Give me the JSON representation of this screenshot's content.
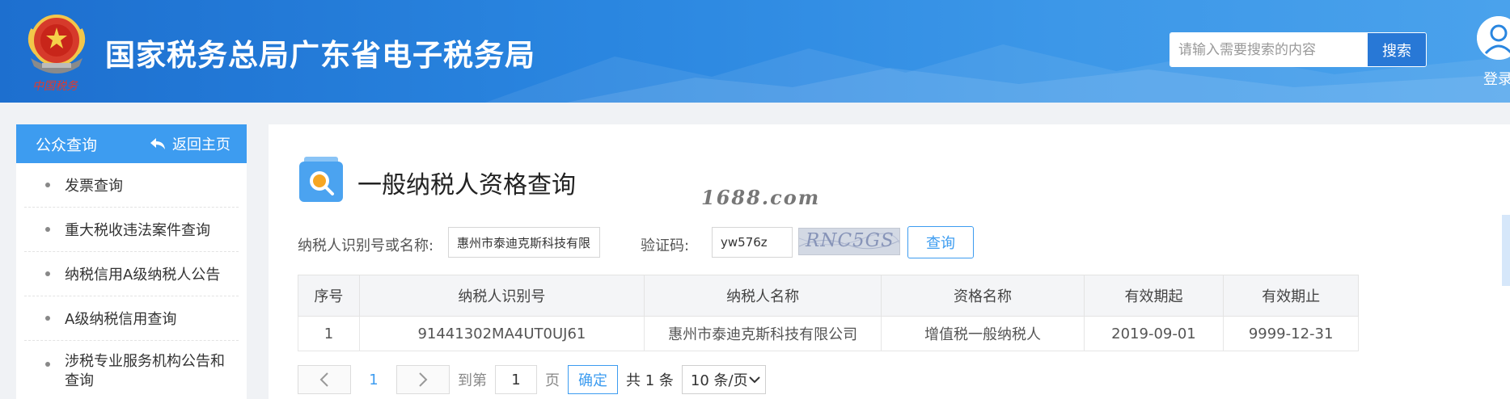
{
  "header": {
    "site_title": "国家税务总局广东省电子税务局",
    "emblem_caption": "中国税务",
    "search_placeholder": "请输入需要搜索的内容",
    "search_button": "搜索",
    "login_label": "登录",
    "colors": {
      "header_blue": "#2a86e0",
      "accent": "#3d9cf0"
    }
  },
  "sidebar": {
    "title": "公众查询",
    "back_label": "返回主页",
    "items": [
      {
        "label": "发票查询"
      },
      {
        "label": "重大税收违法案件查询"
      },
      {
        "label": "纳税信用A级纳税人公告"
      },
      {
        "label": "A级纳税信用查询"
      },
      {
        "label": "涉税专业服务机构公告和查询"
      }
    ]
  },
  "main": {
    "title": "一般纳税人资格查询",
    "watermark": "1688.com",
    "form": {
      "taxpayer_label": "纳税人识别号或名称:",
      "taxpayer_value": "惠州市泰迪克斯科技有限公",
      "captcha_label": "验证码:",
      "captcha_value": "yw576z",
      "captcha_image_text": "RNC5GS",
      "query_button": "查询"
    },
    "table": {
      "columns": [
        "序号",
        "纳税人识别号",
        "纳税人名称",
        "资格名称",
        "有效期起",
        "有效期止"
      ],
      "rows": [
        [
          "1",
          "91441302MA4UT0UJ61",
          "惠州市泰迪克斯科技有限公司",
          "增值税一般纳税人",
          "2019-09-01",
          "9999-12-31"
        ]
      ]
    },
    "pager": {
      "current_page": "1",
      "goto_label": "到第",
      "goto_value": "1",
      "page_unit": "页",
      "confirm": "确定",
      "total": "共 1 条",
      "page_size": "10 条/页"
    }
  }
}
